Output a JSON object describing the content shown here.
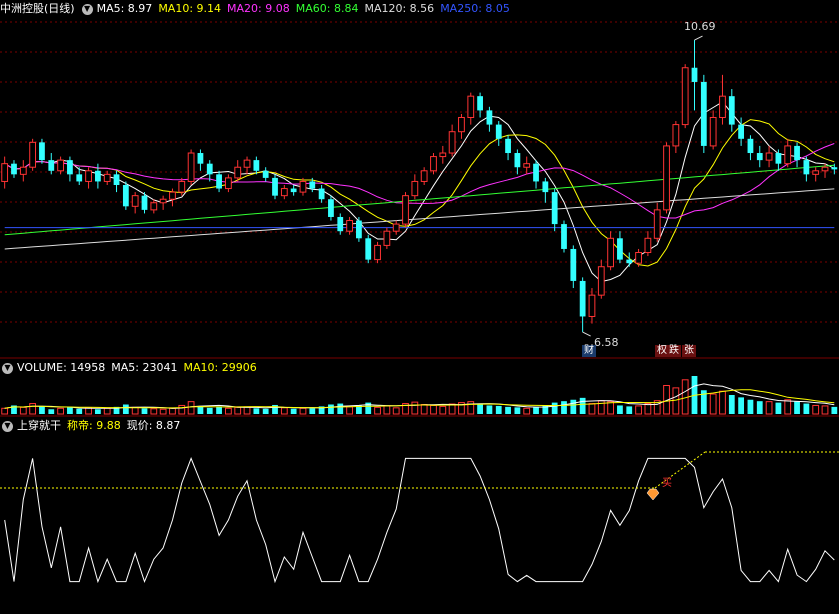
{
  "header_main": {
    "title": "中洲控股(日线)",
    "items": [
      {
        "label": "MA5: 8.97",
        "color": "#ffffff"
      },
      {
        "label": "MA10: 9.14",
        "color": "#ffff00"
      },
      {
        "label": "MA20: 9.08",
        "color": "#ff33ff"
      },
      {
        "label": "MA60: 8.84",
        "color": "#33ff33"
      },
      {
        "label": "MA120: 8.56",
        "color": "#dddddd"
      },
      {
        "label": "MA250: 8.05",
        "color": "#3355ff"
      }
    ]
  },
  "header_volume": {
    "items": [
      {
        "label": "VOLUME: 14958",
        "color": "#ffffff"
      },
      {
        "label": "MA5: 23041",
        "color": "#ffffff"
      },
      {
        "label": "MA10: 29906",
        "color": "#ffff00"
      }
    ]
  },
  "header_indicator": {
    "items": [
      {
        "label": "上穿就干",
        "color": "#ffffff"
      },
      {
        "label": "称帝: 9.88",
        "color": "#ffff00"
      },
      {
        "label": "现价: 8.87",
        "color": "#ffffff"
      }
    ]
  },
  "annotations": {
    "high": "10.69",
    "low": "6.58",
    "low_tag": "财",
    "tag_a": "权",
    "tag_b": "跌",
    "tag_c": "张",
    "ind_tag": "买"
  },
  "colors": {
    "up": "#ff3333",
    "down": "#33ffff",
    "grid": "#7a0000",
    "ma5": "#ffffff",
    "ma10": "#ffff00",
    "ma20": "#ff33ff",
    "ma60": "#33ff33",
    "ma120": "#dddddd",
    "ma250": "#3355ff"
  },
  "chart_data": {
    "type": "candlestick",
    "candles": [
      [
        8.7,
        8.95,
        8.6,
        9.05
      ],
      [
        8.95,
        8.8,
        8.75,
        9.0
      ],
      [
        8.8,
        8.9,
        8.7,
        9.0
      ],
      [
        8.9,
        9.25,
        8.85,
        9.3
      ],
      [
        9.25,
        9.0,
        8.95,
        9.3
      ],
      [
        9.0,
        8.85,
        8.8,
        9.1
      ],
      [
        8.85,
        9.0,
        8.8,
        9.05
      ],
      [
        9.0,
        8.8,
        8.7,
        9.05
      ],
      [
        8.8,
        8.7,
        8.65,
        8.9
      ],
      [
        8.7,
        8.85,
        8.6,
        8.9
      ],
      [
        8.85,
        8.7,
        8.6,
        8.95
      ],
      [
        8.7,
        8.8,
        8.65,
        8.85
      ],
      [
        8.8,
        8.65,
        8.55,
        8.85
      ],
      [
        8.65,
        8.35,
        8.3,
        8.7
      ],
      [
        8.35,
        8.5,
        8.25,
        8.55
      ],
      [
        8.5,
        8.3,
        8.25,
        8.55
      ],
      [
        8.3,
        8.4,
        8.25,
        8.45
      ],
      [
        8.4,
        8.45,
        8.3,
        8.5
      ],
      [
        8.45,
        8.55,
        8.35,
        8.6
      ],
      [
        8.55,
        8.7,
        8.5,
        8.75
      ],
      [
        8.7,
        9.1,
        8.65,
        9.15
      ],
      [
        9.1,
        8.95,
        8.85,
        9.15
      ],
      [
        8.95,
        8.8,
        8.7,
        9.0
      ],
      [
        8.8,
        8.6,
        8.55,
        8.85
      ],
      [
        8.6,
        8.75,
        8.55,
        8.8
      ],
      [
        8.75,
        8.9,
        8.7,
        9.0
      ],
      [
        8.9,
        9.0,
        8.8,
        9.05
      ],
      [
        9.0,
        8.85,
        8.8,
        9.05
      ],
      [
        8.85,
        8.75,
        8.7,
        8.9
      ],
      [
        8.75,
        8.5,
        8.45,
        8.8
      ],
      [
        8.5,
        8.6,
        8.45,
        8.65
      ],
      [
        8.6,
        8.55,
        8.5,
        8.65
      ],
      [
        8.55,
        8.7,
        8.5,
        8.75
      ],
      [
        8.7,
        8.6,
        8.55,
        8.75
      ],
      [
        8.6,
        8.45,
        8.4,
        8.65
      ],
      [
        8.45,
        8.2,
        8.15,
        8.5
      ],
      [
        8.2,
        8.0,
        7.95,
        8.25
      ],
      [
        8.0,
        8.15,
        7.95,
        8.2
      ],
      [
        8.15,
        7.9,
        7.85,
        8.2
      ],
      [
        7.9,
        7.6,
        7.55,
        7.95
      ],
      [
        7.6,
        7.8,
        7.55,
        7.85
      ],
      [
        7.8,
        8.0,
        7.75,
        8.05
      ],
      [
        8.0,
        8.1,
        7.95,
        8.15
      ],
      [
        8.1,
        8.5,
        8.05,
        8.55
      ],
      [
        8.5,
        8.7,
        8.45,
        8.8
      ],
      [
        8.7,
        8.85,
        8.65,
        8.9
      ],
      [
        8.85,
        9.05,
        8.8,
        9.1
      ],
      [
        9.05,
        9.1,
        8.95,
        9.2
      ],
      [
        9.1,
        9.4,
        9.05,
        9.5
      ],
      [
        9.4,
        9.6,
        9.3,
        9.65
      ],
      [
        9.6,
        9.9,
        9.5,
        9.95
      ],
      [
        9.9,
        9.7,
        9.6,
        9.95
      ],
      [
        9.7,
        9.5,
        9.4,
        9.75
      ],
      [
        9.5,
        9.3,
        9.2,
        9.55
      ],
      [
        9.3,
        9.1,
        9.0,
        9.35
      ],
      [
        9.1,
        8.9,
        8.8,
        9.15
      ],
      [
        8.9,
        8.95,
        8.8,
        9.05
      ],
      [
        8.95,
        8.7,
        8.6,
        9.0
      ],
      [
        8.7,
        8.55,
        8.4,
        8.75
      ],
      [
        8.55,
        8.1,
        8.0,
        8.6
      ],
      [
        8.1,
        7.75,
        7.7,
        8.15
      ],
      [
        7.75,
        7.3,
        7.2,
        7.8
      ],
      [
        7.3,
        6.8,
        6.58,
        7.35
      ],
      [
        6.8,
        7.1,
        6.7,
        7.2
      ],
      [
        7.1,
        7.5,
        7.05,
        7.6
      ],
      [
        7.5,
        7.9,
        7.45,
        8.0
      ],
      [
        7.9,
        7.6,
        7.55,
        8.0
      ],
      [
        7.6,
        7.55,
        7.5,
        7.7
      ],
      [
        7.55,
        7.7,
        7.5,
        7.75
      ],
      [
        7.7,
        7.9,
        7.65,
        8.0
      ],
      [
        7.9,
        8.3,
        7.85,
        8.4
      ],
      [
        8.3,
        9.2,
        8.25,
        9.25
      ],
      [
        9.2,
        9.5,
        9.1,
        9.55
      ],
      [
        9.5,
        10.3,
        9.45,
        10.35
      ],
      [
        10.3,
        10.1,
        9.7,
        10.69
      ],
      [
        10.1,
        9.2,
        9.1,
        10.2
      ],
      [
        9.2,
        9.6,
        9.15,
        9.7
      ],
      [
        9.6,
        9.9,
        9.5,
        10.2
      ],
      [
        9.9,
        9.5,
        9.4,
        10.0
      ],
      [
        9.5,
        9.3,
        9.2,
        9.6
      ],
      [
        9.3,
        9.1,
        9.0,
        9.35
      ],
      [
        9.1,
        9.0,
        8.9,
        9.2
      ],
      [
        9.0,
        9.1,
        8.9,
        9.2
      ],
      [
        9.1,
        8.95,
        8.85,
        9.15
      ],
      [
        8.95,
        9.2,
        8.9,
        9.3
      ],
      [
        9.2,
        9.0,
        8.9,
        9.25
      ],
      [
        9.0,
        8.8,
        8.7,
        9.05
      ],
      [
        8.8,
        8.85,
        8.7,
        8.9
      ],
      [
        8.85,
        8.9,
        8.75,
        8.95
      ],
      [
        8.9,
        8.87,
        8.8,
        8.95
      ]
    ],
    "volume": [
      12,
      18,
      14,
      22,
      16,
      10,
      12,
      14,
      11,
      13,
      10,
      12,
      15,
      20,
      14,
      12,
      11,
      10,
      12,
      18,
      26,
      17,
      13,
      16,
      12,
      14,
      15,
      12,
      11,
      19,
      13,
      11,
      12,
      12,
      16,
      20,
      22,
      15,
      18,
      24,
      14,
      17,
      13,
      22,
      25,
      20,
      18,
      16,
      21,
      24,
      26,
      20,
      18,
      17,
      15,
      14,
      12,
      15,
      18,
      24,
      27,
      30,
      34,
      22,
      28,
      26,
      18,
      16,
      17,
      22,
      28,
      60,
      55,
      72,
      80,
      50,
      42,
      48,
      40,
      35,
      30,
      27,
      26,
      24,
      30,
      26,
      22,
      18,
      17,
      15
    ],
    "indicator_level": 9.88,
    "current_price": 8.87
  }
}
